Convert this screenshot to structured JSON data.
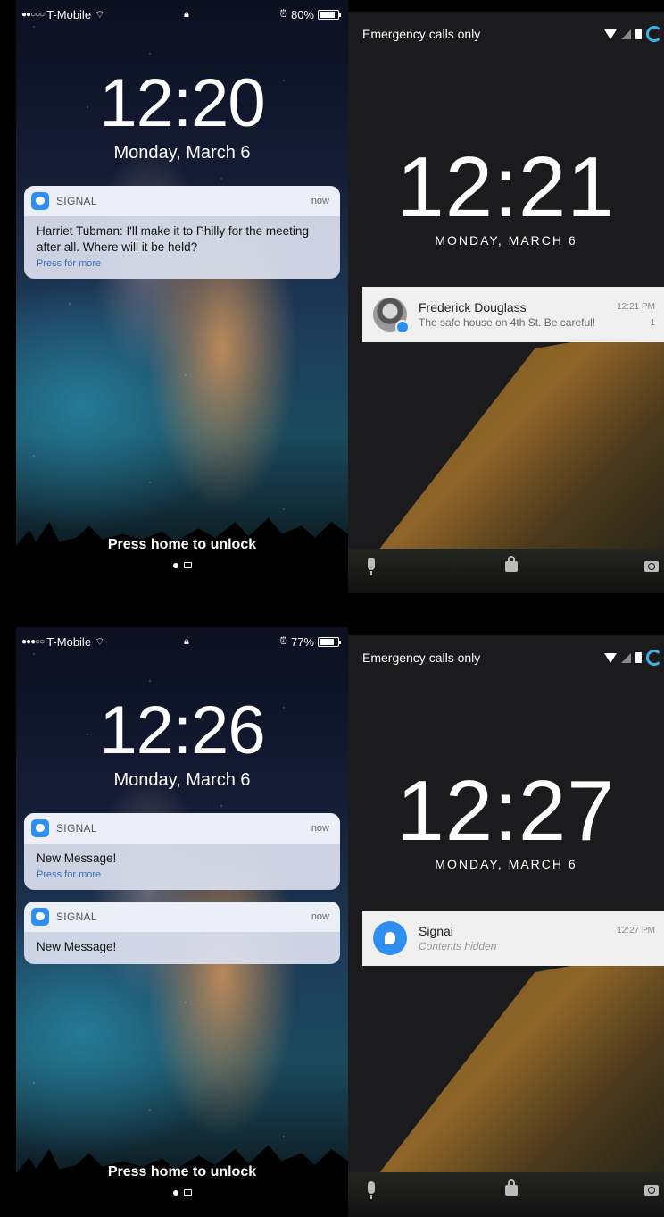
{
  "ios_top": {
    "carrier": "T-Mobile",
    "battery": "80%",
    "battery_level": 0.8,
    "time": "12:20",
    "date": "Monday, March 6",
    "notifications": [
      {
        "app": "SIGNAL",
        "time": "now",
        "message": "Harriet Tubman: I'll make it to Philly for the meeting after all. Where will it be held?",
        "press_more": "Press for more"
      }
    ],
    "unlock_text": "Press home to unlock"
  },
  "android_top": {
    "status_text": "Emergency calls only",
    "time": "12:21",
    "date": "MONDAY, MARCH 6",
    "notification": {
      "title": "Frederick Douglass",
      "subtitle": "The safe house on 4th St. Be careful!",
      "time": "12:21 PM",
      "count": "1"
    }
  },
  "ios_bottom": {
    "carrier": "T-Mobile",
    "battery": "77%",
    "battery_level": 0.77,
    "time": "12:26",
    "date": "Monday, March 6",
    "notifications": [
      {
        "app": "SIGNAL",
        "time": "now",
        "message": "New Message!",
        "press_more": "Press for more"
      },
      {
        "app": "SIGNAL",
        "time": "now",
        "message": "New Message!"
      }
    ],
    "unlock_text": "Press home to unlock"
  },
  "android_bottom": {
    "status_text": "Emergency calls only",
    "time": "12:27",
    "date": "MONDAY, MARCH 6",
    "notification": {
      "title": "Signal",
      "subtitle": "Contents hidden",
      "time": "12:27 PM"
    }
  }
}
